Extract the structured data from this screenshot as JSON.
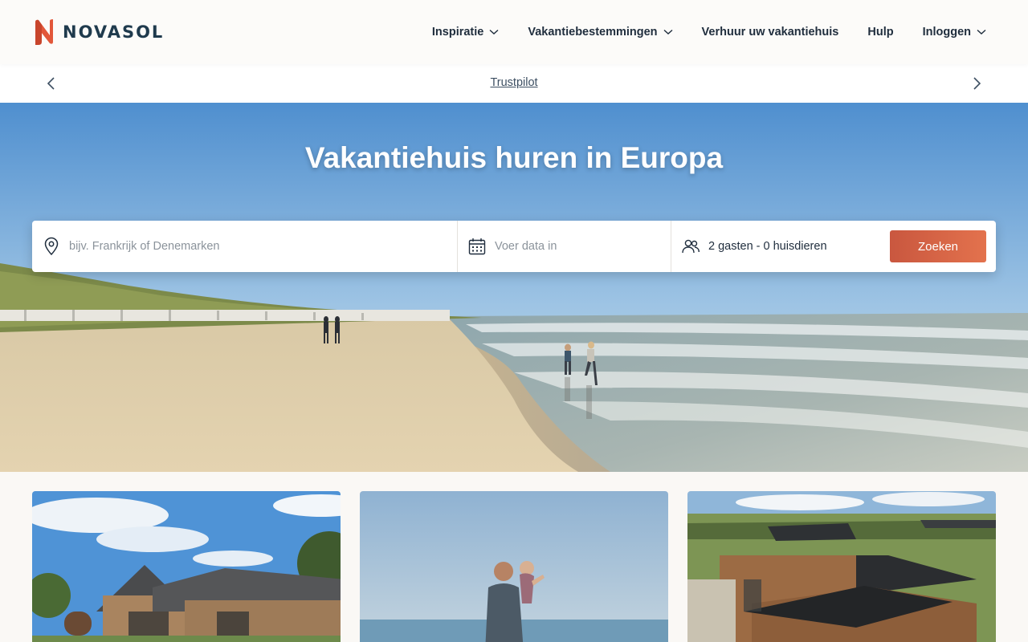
{
  "brand": {
    "name": "NOVASOL",
    "accent": "#e2573a",
    "primary_text": "#1f3a4d"
  },
  "nav": {
    "items": [
      {
        "label": "Inspiratie",
        "has_dropdown": true
      },
      {
        "label": "Vakantiebestemmingen",
        "has_dropdown": true
      },
      {
        "label": "Verhuur uw vakantiehuis",
        "has_dropdown": false
      },
      {
        "label": "Hulp",
        "has_dropdown": false
      },
      {
        "label": "Inloggen",
        "has_dropdown": true
      }
    ]
  },
  "trustpilot": {
    "link_label": "Trustpilot",
    "prev_icon": "chevron-left-icon",
    "next_icon": "chevron-right-icon"
  },
  "hero": {
    "title": "Vakantiehuis huren in Europa"
  },
  "search": {
    "location_placeholder": "bijv. Frankrijk of Denemarken",
    "date_placeholder": "Voer data in",
    "guests_value": "2 gasten - 0 huisdieren",
    "submit_label": "Zoeken",
    "button_color": "#d9623f"
  },
  "cards": [
    {
      "image": "wooden-holiday-house-with-sauna"
    },
    {
      "image": "father-with-child-at-sea"
    },
    {
      "image": "black-roof-houses-in-dunes"
    }
  ]
}
